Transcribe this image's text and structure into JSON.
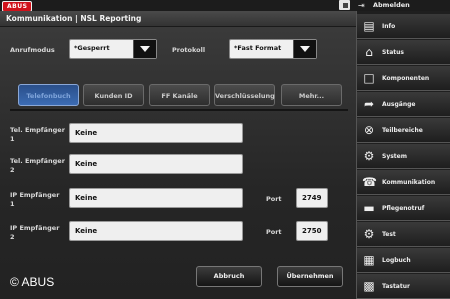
{
  "topbar": {
    "logo": "ABUS",
    "logout_label": "Abmelden"
  },
  "header": {
    "title": "Kommunikation | NSL Reporting"
  },
  "form": {
    "call_mode_label": "Anrufmodus",
    "call_mode_value": "*Gesperrt",
    "protocol_label": "Protokoll",
    "protocol_value": "*Fast Format"
  },
  "tabs": [
    {
      "label": "Telefonbuch",
      "active": true
    },
    {
      "label": "Kunden ID",
      "active": false
    },
    {
      "label": "FF Kanäle",
      "active": false
    },
    {
      "label": "Verschlüsselung",
      "active": false
    },
    {
      "label": "Mehr...",
      "active": false
    }
  ],
  "recipients": [
    {
      "label_line1": "Tel. Empfänger",
      "label_line2": "1",
      "value": "Keine"
    },
    {
      "label_line1": "Tel. Empfänger",
      "label_line2": "2",
      "value": "Keine"
    },
    {
      "label_line1": "IP Empfänger",
      "label_line2": "1",
      "value": "Keine",
      "port_label": "Port",
      "port_value": "2749"
    },
    {
      "label_line1": "IP Empfänger",
      "label_line2": "2",
      "value": "Keine",
      "port_label": "Port",
      "port_value": "2750"
    }
  ],
  "actions": {
    "cancel": "Abbruch",
    "apply": "Übernehmen"
  },
  "copyright": "© ABUS",
  "sidebar": {
    "items": [
      {
        "label": "Info",
        "icon": "info-icon"
      },
      {
        "label": "Status",
        "icon": "home-icon"
      },
      {
        "label": "Komponenten",
        "icon": "component-icon"
      },
      {
        "label": "Ausgänge",
        "icon": "output-icon"
      },
      {
        "label": "Teilbereiche",
        "icon": "partition-icon"
      },
      {
        "label": "System",
        "icon": "gear-icon"
      },
      {
        "label": "Kommunikation",
        "icon": "phone-icon"
      },
      {
        "label": "Pflegenotruf",
        "icon": "bed-icon"
      },
      {
        "label": "Test",
        "icon": "gear-icon"
      },
      {
        "label": "Logbuch",
        "icon": "logbook-icon"
      },
      {
        "label": "Tastatur",
        "icon": "keypad-icon"
      }
    ]
  }
}
